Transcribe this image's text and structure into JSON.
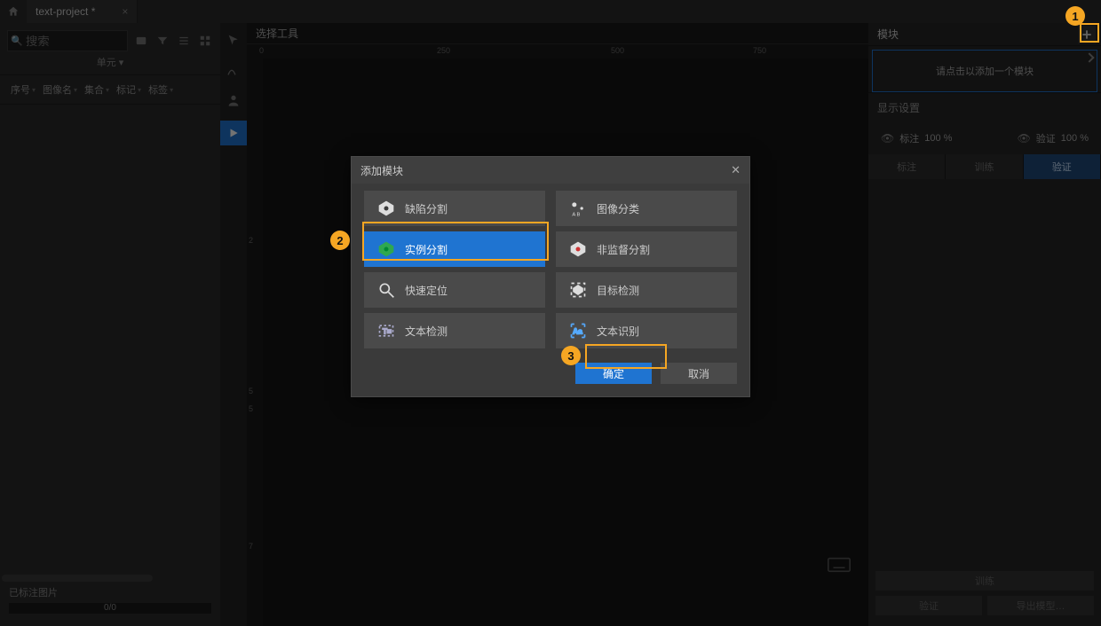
{
  "topbar": {
    "project_tab": "text-project *"
  },
  "left": {
    "search_placeholder": "搜索",
    "unit_label": "单元 ▾",
    "filters": {
      "seq": "序号",
      "image": "图像名",
      "set": "集合",
      "mark": "标记",
      "tag": "标签"
    },
    "labeled_label": "已标注图片",
    "progress_text": "0/0"
  },
  "center": {
    "toolbar_title": "选择工具",
    "ruler_marks_h": [
      "0",
      "250",
      "500",
      "750"
    ],
    "ruler_marks_v": [
      "2",
      "5",
      "5",
      "7"
    ]
  },
  "right": {
    "header": "模块",
    "hint": "请点击以添加一个模块",
    "display_section": "显示设置",
    "vis_annot": "标注",
    "vis_verify": "验证",
    "pct": "100 %",
    "tabs": {
      "annot": "标注",
      "train": "训练",
      "verify": "验证"
    },
    "bottom": {
      "train": "训练",
      "export_model": "导出模型…"
    }
  },
  "dialog": {
    "title": "添加模块",
    "modules": {
      "defect_seg": "缺陷分割",
      "img_cls": "图像分类",
      "inst_seg": "实例分割",
      "unsup_seg": "非监督分割",
      "fast_loc": "快速定位",
      "obj_det": "目标检测",
      "text_det": "文本检测",
      "text_rec": "文本识别"
    },
    "ok": "确定",
    "cancel": "取消"
  },
  "callouts": {
    "c1": "1",
    "c2": "2",
    "c3": "3"
  }
}
